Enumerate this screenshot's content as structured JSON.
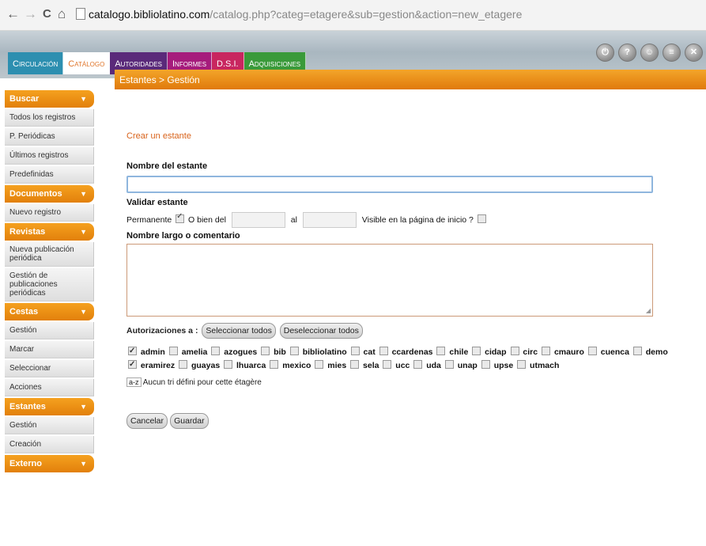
{
  "browser": {
    "back": "←",
    "forward": "→",
    "reload": "C",
    "home": "⌂",
    "url_host": "catalogo.bibliolatino.com",
    "url_path": "/catalog.php?categ=etagere&sub=gestion&action=new_etagere"
  },
  "tabs": [
    {
      "label": "Circulación"
    },
    {
      "label": "Catálogo"
    },
    {
      "label": "Autoridades"
    },
    {
      "label": "Informes"
    },
    {
      "label": "D.S.I."
    },
    {
      "label": "Adquisiciones"
    }
  ],
  "top_icons": [
    "power-icon",
    "help-icon",
    "users-icon",
    "document-icon",
    "close-icon"
  ],
  "sidebar": {
    "sections": [
      {
        "title": "Buscar",
        "items": [
          "Todos los registros",
          "P. Periódicas",
          "Últimos registros",
          "Predefinidas"
        ]
      },
      {
        "title": "Documentos",
        "items": [
          "Nuevo registro"
        ]
      },
      {
        "title": "Revistas",
        "items": [
          "Nueva publicación periódica",
          "Gestión de publicaciones periódicas"
        ]
      },
      {
        "title": "Cestas",
        "items": [
          "Gestión",
          "Marcar",
          "Seleccionar",
          "Acciones"
        ]
      },
      {
        "title": "Estantes",
        "items": [
          "Gestión",
          "Creación"
        ]
      },
      {
        "title": "Externo",
        "items": []
      }
    ]
  },
  "main": {
    "breadcrumb": "Estantes > Gestión",
    "form_title": "Crear un estante",
    "nombre_label": "Nombre del estante",
    "nombre_value": "",
    "validar_label": "Validar estante",
    "permanente_label": "Permanente",
    "o_bien_label": "O bien del",
    "al_label": "al",
    "visible_label": "Visible en la página de inicio ?",
    "comentario_label": "Nombre largo o comentario",
    "autorizaciones_label": "Autorizaciones a :",
    "select_all": "Seleccionar todos",
    "deselect_all": "Deseleccionar todos",
    "users": [
      {
        "name": "admin",
        "checked": true
      },
      {
        "name": "amelia",
        "checked": false
      },
      {
        "name": "azogues",
        "checked": false
      },
      {
        "name": "bib",
        "checked": false
      },
      {
        "name": "bibliolatino",
        "checked": false
      },
      {
        "name": "cat",
        "checked": false
      },
      {
        "name": "ccardenas",
        "checked": false
      },
      {
        "name": "chile",
        "checked": false
      },
      {
        "name": "cidap",
        "checked": false
      },
      {
        "name": "circ",
        "checked": false
      },
      {
        "name": "cmauro",
        "checked": false
      },
      {
        "name": "cuenca",
        "checked": false
      },
      {
        "name": "demo",
        "checked": false
      },
      {
        "name": "eramirez",
        "checked": true
      },
      {
        "name": "guayas",
        "checked": false
      },
      {
        "name": "lhuarca",
        "checked": false
      },
      {
        "name": "mexico",
        "checked": false
      },
      {
        "name": "mies",
        "checked": false
      },
      {
        "name": "sela",
        "checked": false
      },
      {
        "name": "ucc",
        "checked": false
      },
      {
        "name": "uda",
        "checked": false
      },
      {
        "name": "unap",
        "checked": false
      },
      {
        "name": "upse",
        "checked": false
      },
      {
        "name": "utmach",
        "checked": false
      }
    ],
    "sort_icon": "a-z",
    "sort_text": "Aucun tri défini pour cette étagère",
    "cancel": "Cancelar",
    "save": "Guardar"
  },
  "colors": {
    "accent_orange": "#e07a0c",
    "title_orange": "#d8621a"
  }
}
